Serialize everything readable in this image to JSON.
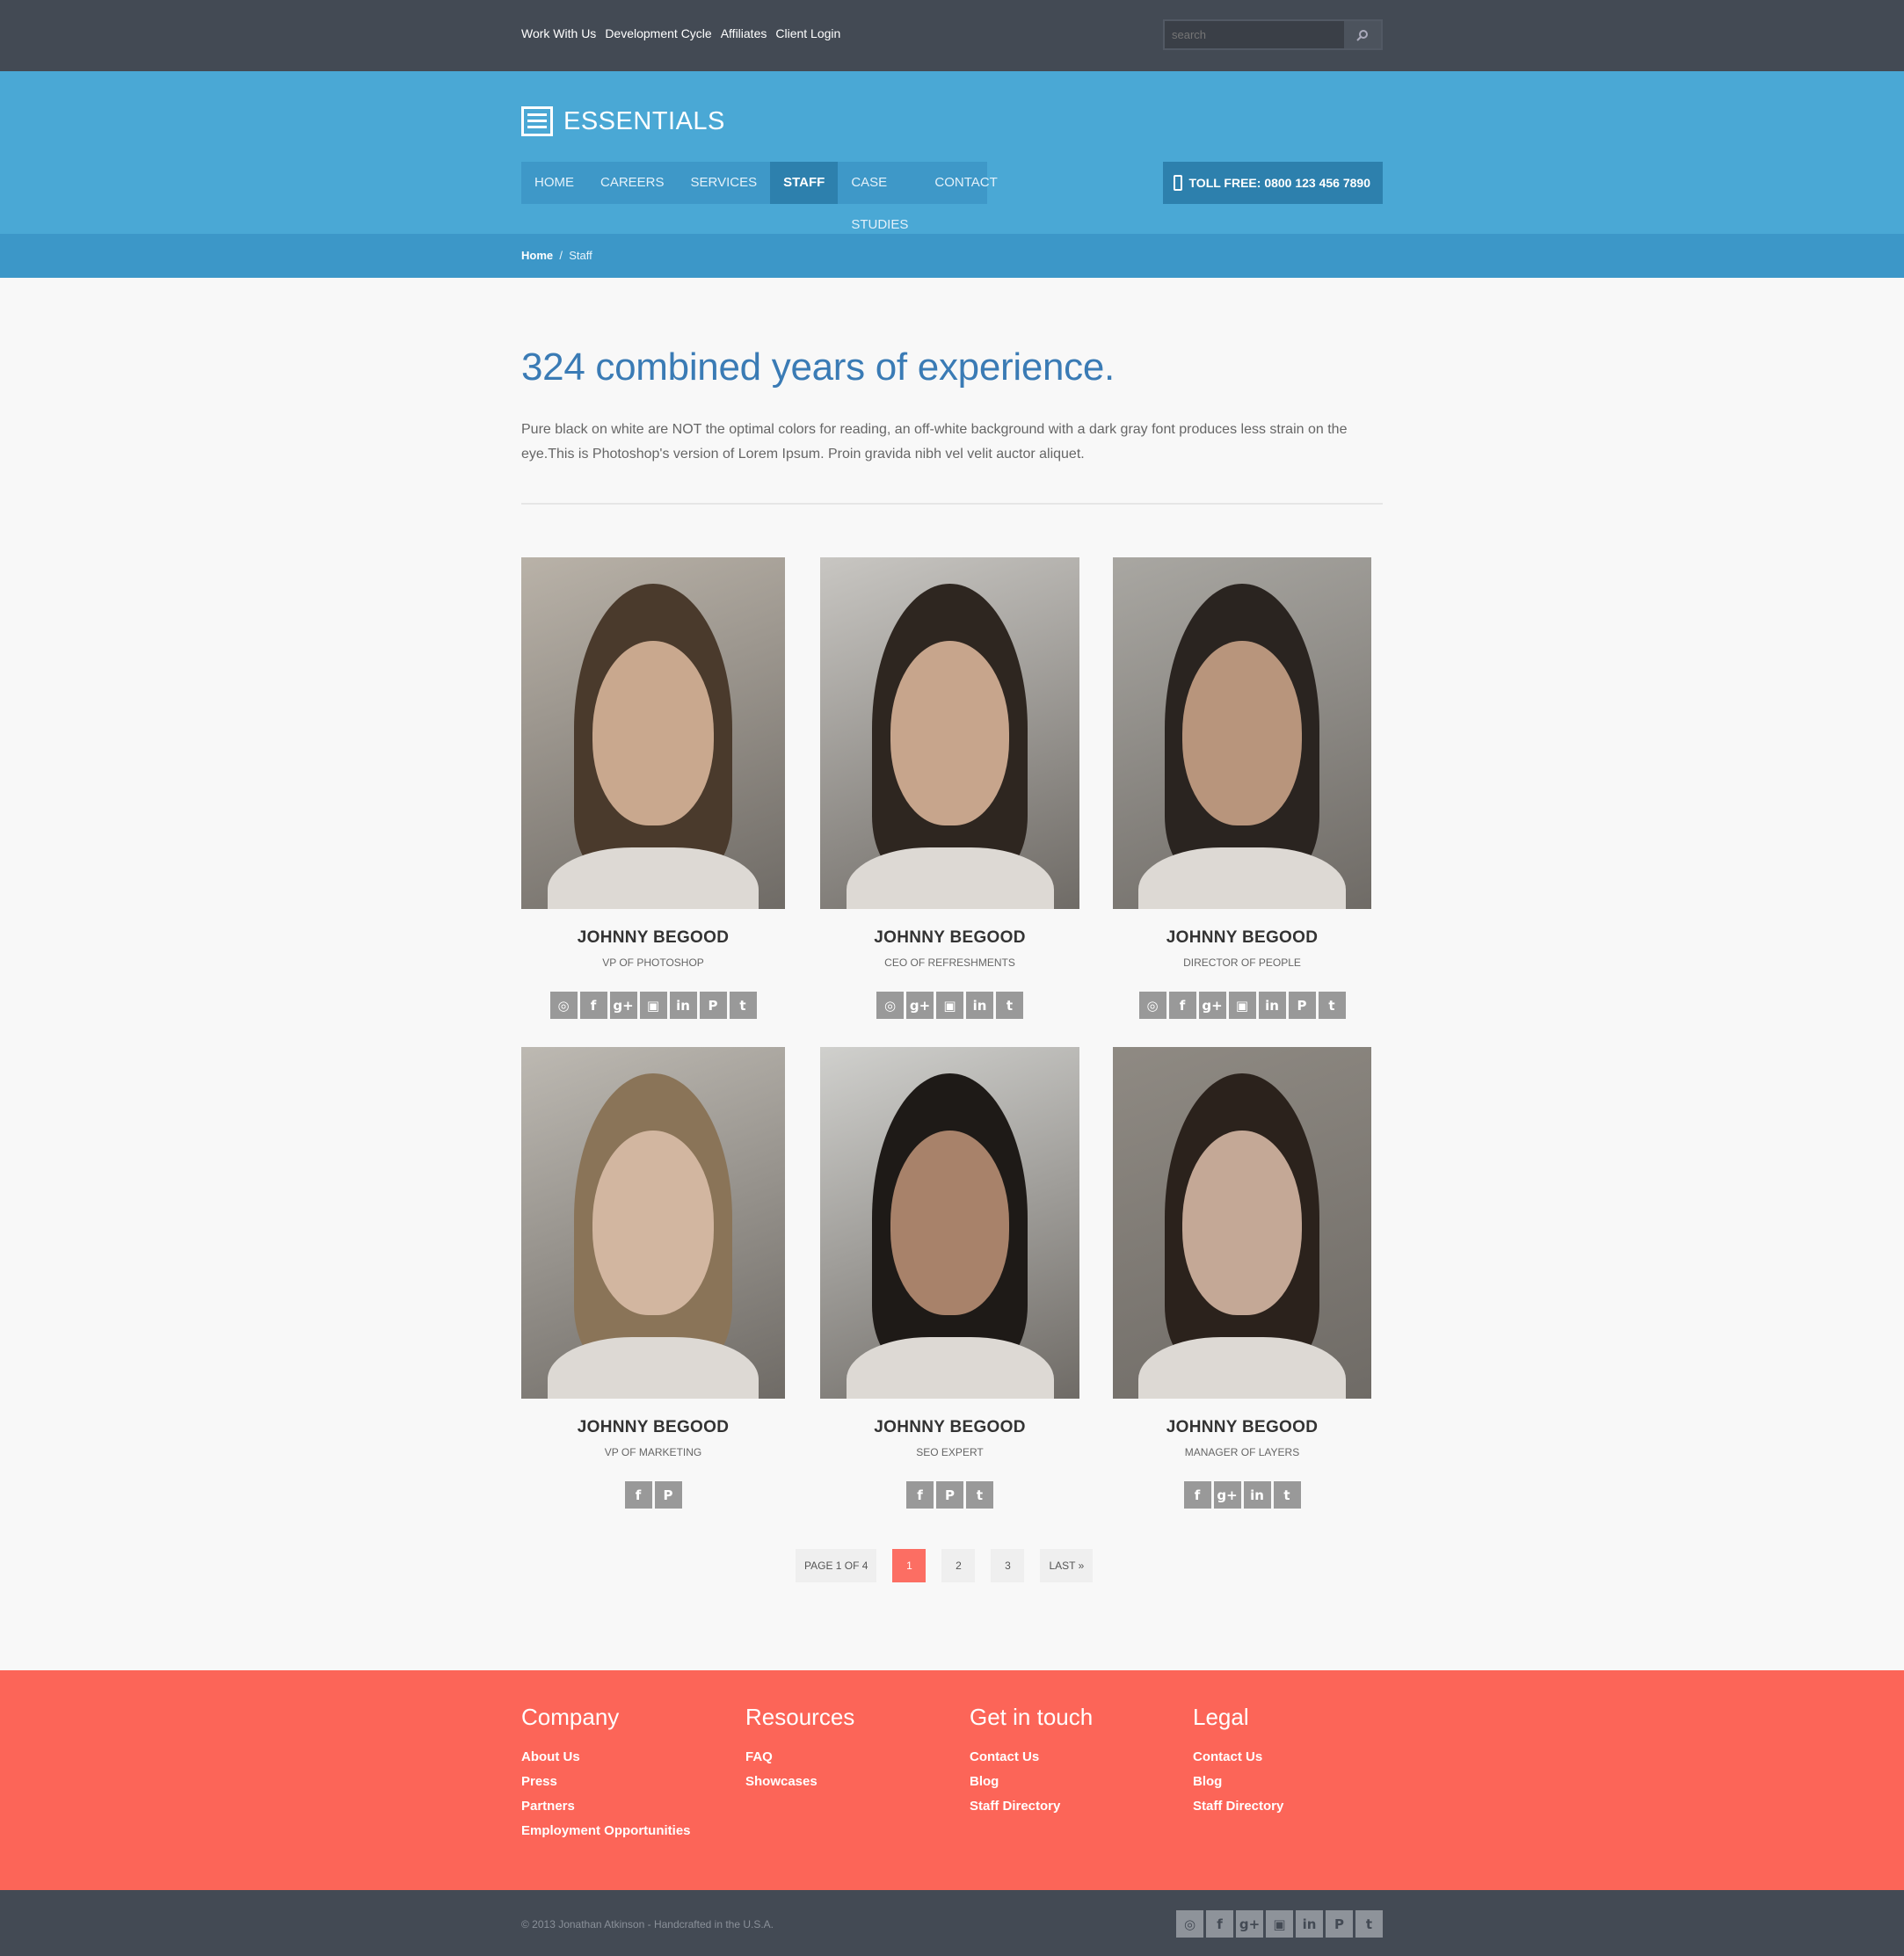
{
  "topbar": {
    "links": [
      "Work With Us",
      "Development Cycle",
      "Affiliates",
      "Client Login"
    ],
    "search_placeholder": "search"
  },
  "header": {
    "brand": "ESSENTIALS",
    "nav": [
      "HOME",
      "CAREERS",
      "SERVICES",
      "STAFF",
      "CASE STUDIES",
      "CONTACT"
    ],
    "active_nav": "STAFF",
    "toll_free": "TOLL FREE: 0800 123 456 7890"
  },
  "breadcrumb": {
    "home": "Home",
    "separator": "/",
    "current": "Staff"
  },
  "intro": {
    "heading": "324 combined years of experience.",
    "body": "Pure black on white are NOT the optimal colors for reading, an off-white background with a dark gray font produces less strain on the eye.This is Photoshop's version of Lorem Ipsum. Proin gravida nibh vel velit auctor aliquet."
  },
  "staff": [
    {
      "name": "JOHNNY BEGOOD",
      "role": "VP OF PHOTOSHOP",
      "socials": [
        "dribbble",
        "facebook",
        "google-plus",
        "instagram",
        "linkedin",
        "pinterest",
        "twitter"
      ]
    },
    {
      "name": "JOHNNY BEGOOD",
      "role": "CEO OF REFRESHMENTS",
      "socials": [
        "dribbble",
        "google-plus",
        "instagram",
        "linkedin",
        "twitter"
      ]
    },
    {
      "name": "JOHNNY BEGOOD",
      "role": "DIRECTOR OF PEOPLE",
      "socials": [
        "dribbble",
        "facebook",
        "google-plus",
        "instagram",
        "linkedin",
        "pinterest",
        "twitter"
      ]
    },
    {
      "name": "JOHNNY BEGOOD",
      "role": "VP OF MARKETING",
      "socials": [
        "facebook",
        "pinterest"
      ]
    },
    {
      "name": "JOHNNY BEGOOD",
      "role": "SEO EXPERT",
      "socials": [
        "facebook",
        "pinterest",
        "twitter"
      ]
    },
    {
      "name": "JOHNNY BEGOOD",
      "role": "MANAGER OF LAYERS",
      "socials": [
        "facebook",
        "google-plus",
        "linkedin",
        "twitter"
      ]
    }
  ],
  "pagination": {
    "summary": "PAGE 1 OF 4",
    "pages": [
      "1",
      "2",
      "3"
    ],
    "current": "1",
    "last": "LAST »"
  },
  "footer": {
    "columns": [
      {
        "title": "Company",
        "links": [
          "About Us",
          "Press",
          "Partners",
          "Employment Opportunities"
        ]
      },
      {
        "title": "Resources",
        "links": [
          "FAQ",
          "Showcases"
        ]
      },
      {
        "title": "Get in touch",
        "links": [
          "Contact Us",
          "Blog",
          "Staff Directory"
        ]
      },
      {
        "title": "Legal",
        "links": [
          "Contact Us",
          "Blog",
          "Staff Directory"
        ]
      }
    ],
    "copyright": "© 2013 Jonathan Atkinson - Handcrafted in the U.S.A.",
    "socials": [
      "dribbble",
      "facebook",
      "google-plus",
      "instagram",
      "linkedin",
      "pinterest",
      "twitter"
    ]
  },
  "colors": {
    "topbar": "#434a54",
    "header": "#4aa8d5",
    "nav_active": "#2d80ad",
    "accent": "#fc6558",
    "heading": "#3a7bb5"
  }
}
